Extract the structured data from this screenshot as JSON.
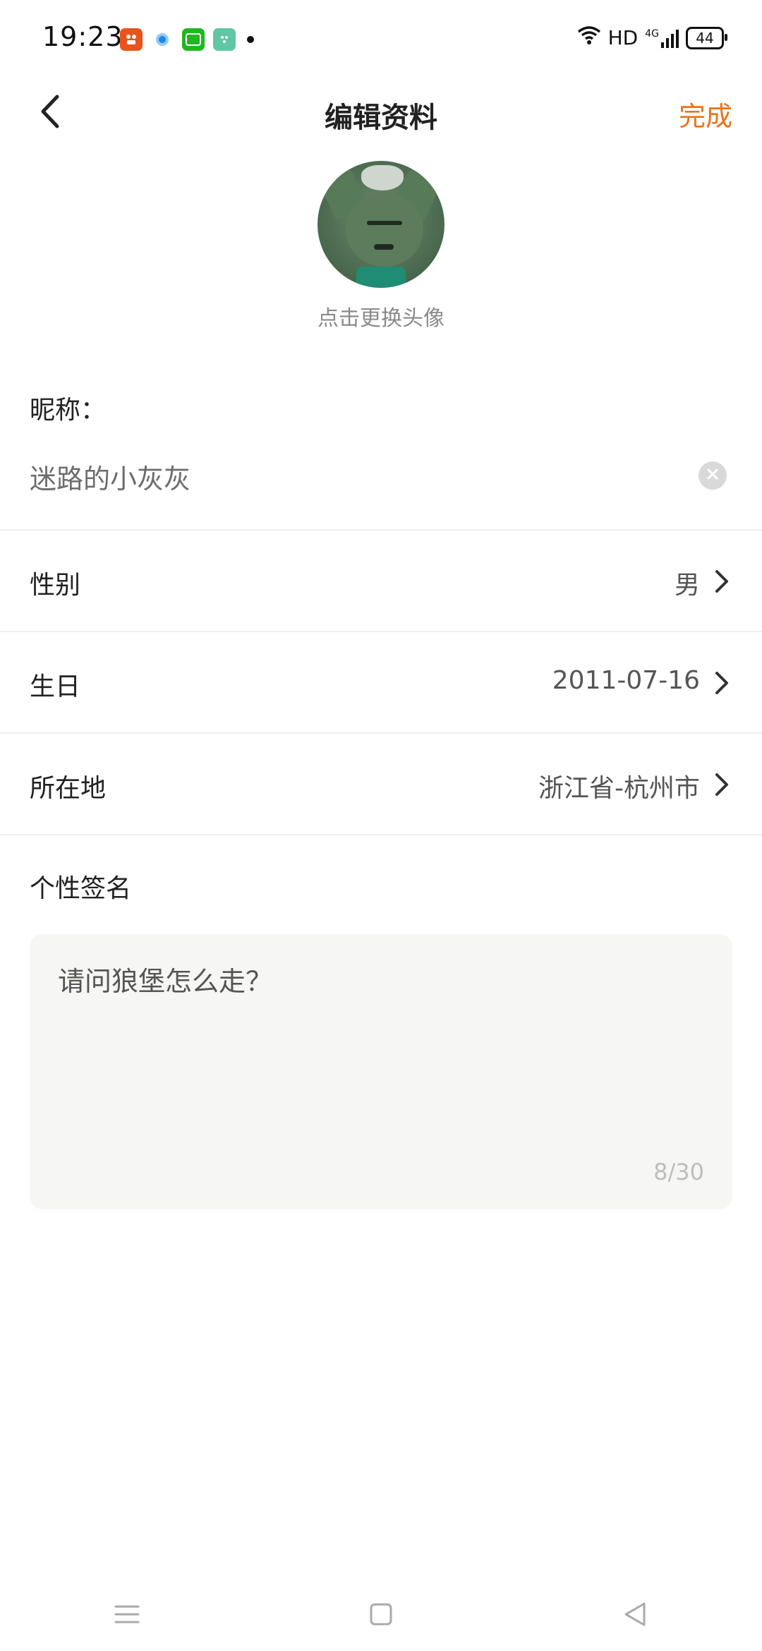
{
  "status_bar": {
    "time": "19:23",
    "hd": "HD",
    "network": "4G",
    "battery": "44"
  },
  "header": {
    "title": "编辑资料",
    "done_label": "完成"
  },
  "avatar": {
    "hint": "点击更换头像"
  },
  "nickname": {
    "label": "昵称：",
    "value": "迷路的小灰灰"
  },
  "rows": [
    {
      "label": "性别",
      "value": "男"
    },
    {
      "label": "生日",
      "value": "2011-07-16"
    },
    {
      "label": "所在地",
      "value": "浙江省-杭州市"
    }
  ],
  "signature": {
    "label": "个性签名",
    "value": "请问狼堡怎么走？",
    "count": "8/30"
  },
  "colors": {
    "accent": "#e8741b",
    "clear_button": "#d9d9d9",
    "signature_bg": "#f6f6f4"
  },
  "icons": {
    "back": "chevron-left-icon",
    "clear": "clear-icon",
    "row_arrow": "chevron-right-icon",
    "nav": [
      "menu-icon",
      "home-icon",
      "back-triangle-icon"
    ]
  }
}
